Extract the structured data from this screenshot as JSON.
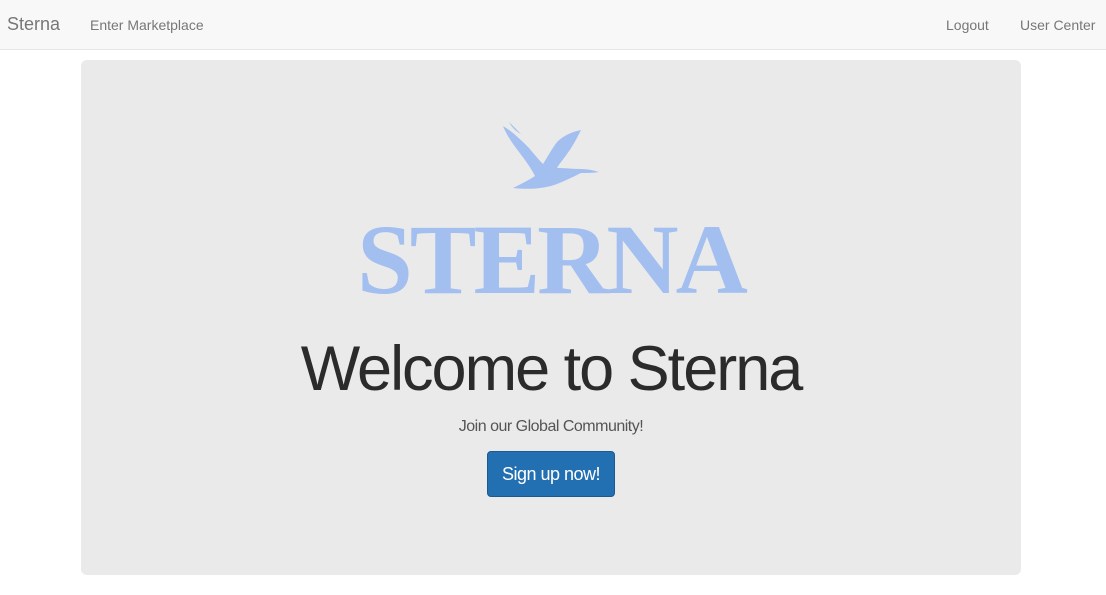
{
  "navbar": {
    "brand": "Sterna",
    "links": {
      "marketplace": "Enter Marketplace",
      "logout": "Logout",
      "user_center": "User Center"
    }
  },
  "hero": {
    "logo_icon": "flying-bird-icon",
    "logo_text": "STERNA",
    "title": "Welcome to Sterna",
    "subtitle": "Join our Global Community!",
    "cta_label": "Sign up now!"
  },
  "colors": {
    "logo": "#a2bff0",
    "cta_background": "#2270b2",
    "jumbotron_background": "#eaeaea",
    "navbar_background": "#f8f8f8"
  }
}
